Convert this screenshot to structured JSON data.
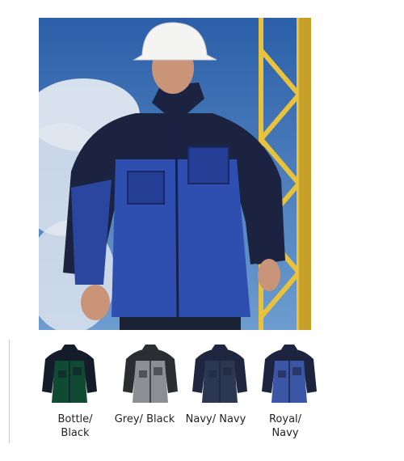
{
  "colour_options": [
    {
      "label": "Bottle/\nBlack",
      "body_color": "#0f4a33",
      "trim_color": "#141c2a"
    },
    {
      "label": "Grey/ Black",
      "body_color": "#8b8f93",
      "trim_color": "#2a2d31"
    },
    {
      "label": "Navy/ Navy",
      "body_color": "#2c3752",
      "trim_color": "#1f2740"
    },
    {
      "label": "Royal/\nNavy",
      "body_color": "#3c56a6",
      "trim_color": "#1c2440"
    }
  ],
  "hero_image": {
    "jacket_body_color": "#2f4fb0",
    "jacket_trim_color": "#1b2340",
    "sky_color": "#3a6fb5",
    "crane_color": "#e8c23a",
    "helmet_color": "#f4f4f2"
  }
}
